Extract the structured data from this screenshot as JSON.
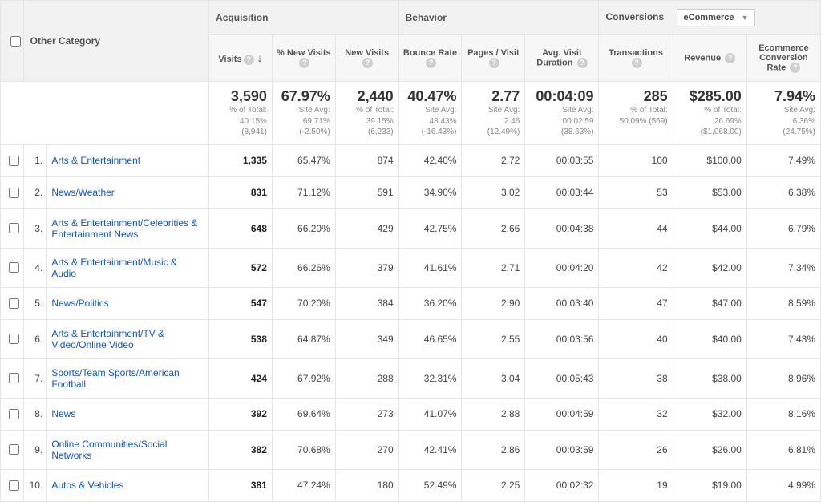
{
  "dimension_label": "Other Category",
  "groups": {
    "acquisition": "Acquisition",
    "behavior": "Behavior",
    "conversions": "Conversions"
  },
  "conversions_selector": {
    "label": "eCommerce"
  },
  "columns": {
    "visits": "Visits",
    "pct_new_visits": "% New Visits",
    "new_visits": "New Visits",
    "bounce_rate": "Bounce Rate",
    "pages_visit": "Pages / Visit",
    "avg_duration": "Avg. Visit Duration",
    "transactions": "Transactions",
    "revenue": "Revenue",
    "ecr": "Ecommerce Conversion Rate"
  },
  "summary": {
    "visits": {
      "big": "3,590",
      "sub1": "% of Total:",
      "sub2": "40.15%",
      "sub3": "(8,941)"
    },
    "pct_new_visits": {
      "big": "67.97%",
      "sub1": "Site Avg:",
      "sub2": "69.71%",
      "sub3": "(-2.50%)"
    },
    "new_visits": {
      "big": "2,440",
      "sub1": "% of Total:",
      "sub2": "39.15%",
      "sub3": "(6,233)"
    },
    "bounce_rate": {
      "big": "40.47%",
      "sub1": "Site Avg:",
      "sub2": "48.43%",
      "sub3": "(-16.43%)"
    },
    "pages_visit": {
      "big": "2.77",
      "sub1": "Site Avg:",
      "sub2": "2.46",
      "sub3": "(12.49%)"
    },
    "avg_duration": {
      "big": "00:04:09",
      "sub1": "Site Avg:",
      "sub2": "00:02:59",
      "sub3": "(38.63%)"
    },
    "transactions": {
      "big": "285",
      "sub1": "% of Total:",
      "sub2": "50.09% (569)",
      "sub3": ""
    },
    "revenue": {
      "big": "$285.00",
      "sub1": "% of Total:",
      "sub2": "26.69%",
      "sub3": "($1,068.00)"
    },
    "ecr": {
      "big": "7.94%",
      "sub1": "Site Avg:",
      "sub2": "6.36%",
      "sub3": "(24.75%)"
    }
  },
  "rows": [
    {
      "idx": "1.",
      "category": "Arts & Entertainment",
      "visits": "1,335",
      "pct_new_visits": "65.47%",
      "new_visits": "874",
      "bounce_rate": "42.40%",
      "pages_visit": "2.72",
      "avg_duration": "00:03:55",
      "transactions": "100",
      "revenue": "$100.00",
      "ecr": "7.49%"
    },
    {
      "idx": "2.",
      "category": "News/Weather",
      "visits": "831",
      "pct_new_visits": "71.12%",
      "new_visits": "591",
      "bounce_rate": "34.90%",
      "pages_visit": "3.02",
      "avg_duration": "00:03:44",
      "transactions": "53",
      "revenue": "$53.00",
      "ecr": "6.38%"
    },
    {
      "idx": "3.",
      "category": "Arts & Entertainment/Celebrities & Entertainment News",
      "visits": "648",
      "pct_new_visits": "66.20%",
      "new_visits": "429",
      "bounce_rate": "42.75%",
      "pages_visit": "2.66",
      "avg_duration": "00:04:38",
      "transactions": "44",
      "revenue": "$44.00",
      "ecr": "6.79%"
    },
    {
      "idx": "4.",
      "category": "Arts & Entertainment/Music & Audio",
      "visits": "572",
      "pct_new_visits": "66.26%",
      "new_visits": "379",
      "bounce_rate": "41.61%",
      "pages_visit": "2.71",
      "avg_duration": "00:04:20",
      "transactions": "42",
      "revenue": "$42.00",
      "ecr": "7.34%"
    },
    {
      "idx": "5.",
      "category": "News/Politics",
      "visits": "547",
      "pct_new_visits": "70.20%",
      "new_visits": "384",
      "bounce_rate": "36.20%",
      "pages_visit": "2.90",
      "avg_duration": "00:03:40",
      "transactions": "47",
      "revenue": "$47.00",
      "ecr": "8.59%"
    },
    {
      "idx": "6.",
      "category": "Arts & Entertainment/TV & Video/Online Video",
      "visits": "538",
      "pct_new_visits": "64.87%",
      "new_visits": "349",
      "bounce_rate": "46.65%",
      "pages_visit": "2.55",
      "avg_duration": "00:03:56",
      "transactions": "40",
      "revenue": "$40.00",
      "ecr": "7.43%"
    },
    {
      "idx": "7.",
      "category": "Sports/Team Sports/American Football",
      "visits": "424",
      "pct_new_visits": "67.92%",
      "new_visits": "288",
      "bounce_rate": "32.31%",
      "pages_visit": "3.04",
      "avg_duration": "00:05:43",
      "transactions": "38",
      "revenue": "$38.00",
      "ecr": "8.96%"
    },
    {
      "idx": "8.",
      "category": "News",
      "visits": "392",
      "pct_new_visits": "69.64%",
      "new_visits": "273",
      "bounce_rate": "41.07%",
      "pages_visit": "2.88",
      "avg_duration": "00:04:59",
      "transactions": "32",
      "revenue": "$32.00",
      "ecr": "8.16%"
    },
    {
      "idx": "9.",
      "category": "Online Communities/Social Networks",
      "visits": "382",
      "pct_new_visits": "70.68%",
      "new_visits": "270",
      "bounce_rate": "42.41%",
      "pages_visit": "2.86",
      "avg_duration": "00:03:59",
      "transactions": "26",
      "revenue": "$26.00",
      "ecr": "6.81%"
    },
    {
      "idx": "10.",
      "category": "Autos & Vehicles",
      "visits": "381",
      "pct_new_visits": "47.24%",
      "new_visits": "180",
      "bounce_rate": "52.49%",
      "pages_visit": "2.25",
      "avg_duration": "00:02:32",
      "transactions": "19",
      "revenue": "$19.00",
      "ecr": "4.99%"
    }
  ]
}
